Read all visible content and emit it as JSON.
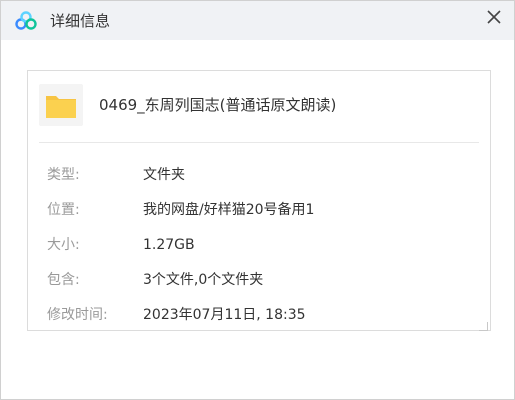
{
  "titlebar": {
    "title": "详细信息",
    "logo_icon": "baidu-netdisk-cloud-icon",
    "close_icon": "close-icon",
    "logo_colors": [
      "#3a8bff",
      "#5bd3ff",
      "#0fc49a"
    ]
  },
  "file": {
    "icon": "folder-icon",
    "icon_color": "#f7c443",
    "name": "0469_东周列国志(普通话原文朗读)"
  },
  "properties": [
    {
      "label": "类型:",
      "value": "文件夹"
    },
    {
      "label": "位置:",
      "value": "我的网盘/好样猫20号备用1"
    },
    {
      "label": "大小:",
      "value": "1.27GB"
    },
    {
      "label": "包含:",
      "value": "3个文件,0个文件夹"
    },
    {
      "label": "修改时间:",
      "value": "2023年07月11日, 18:35"
    }
  ]
}
